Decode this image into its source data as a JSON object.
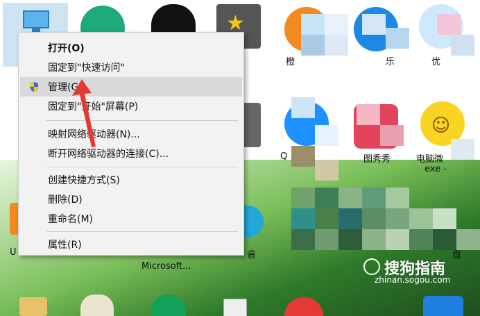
{
  "context_menu": {
    "items": [
      {
        "label": "打开(O)"
      },
      {
        "label": "固定到\"快速访问\""
      },
      {
        "label": "管理(G)"
      },
      {
        "label": "固定到\"开始\"屏幕(P)"
      },
      {
        "label": "映射网络驱动器(N)..."
      },
      {
        "label": "断开网络驱动器的连接(C)..."
      },
      {
        "label": "创建快捷方式(S)"
      },
      {
        "label": "删除(D)"
      },
      {
        "label": "重命名(M)"
      },
      {
        "label": "属性(R)"
      }
    ]
  },
  "desktop": {
    "labels": {
      "microsoft": "Microsoft...",
      "cheng": "橙",
      "le": "乐",
      "you": "优",
      "q": "Q",
      "tuxiu": "图秀秀",
      "diannao": "电脑微",
      "exe": "exe -",
      "yin": "音",
      "pan": "盘",
      "u": "U"
    }
  },
  "watermark": {
    "brand": "搜狗指南",
    "url": "zhinan.sogou.com"
  },
  "colors": {
    "menu_bg": "#f2f2f2",
    "menu_highlight": "#d9d9d9",
    "arrow": "#e53935"
  }
}
